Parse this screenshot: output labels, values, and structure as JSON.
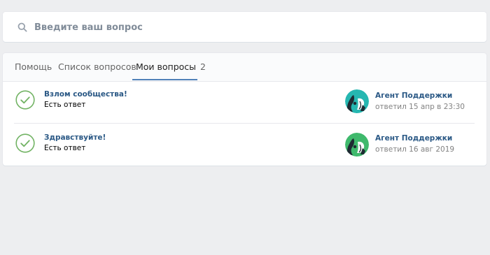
{
  "search": {
    "placeholder": "Введите ваш вопрос",
    "icon": "search-icon"
  },
  "tabs": [
    {
      "label": "Помощь",
      "active": false
    },
    {
      "label": "Список вопросов",
      "active": false
    },
    {
      "label": "Мои вопросы",
      "active": true,
      "count": "2"
    }
  ],
  "questions": [
    {
      "title": "Взлом сообщества!",
      "status": "Есть ответ",
      "status_icon": "check-circle-icon",
      "agent": "Агент Поддержки",
      "answered": "ответил 15 апр в 23:30"
    },
    {
      "title": "Здравствуйте!",
      "status": "Есть ответ",
      "status_icon": "check-circle-icon",
      "agent": "Агент Поддержки",
      "answered": "ответил 16 авг 2019"
    }
  ],
  "colors": {
    "background": "#edeef0",
    "link": "#2a5885",
    "active_tab_underline": "#5181b8",
    "check_green": "#72b364",
    "avatar_teal": "#26b7b1",
    "avatar_green": "#3fb96c"
  }
}
